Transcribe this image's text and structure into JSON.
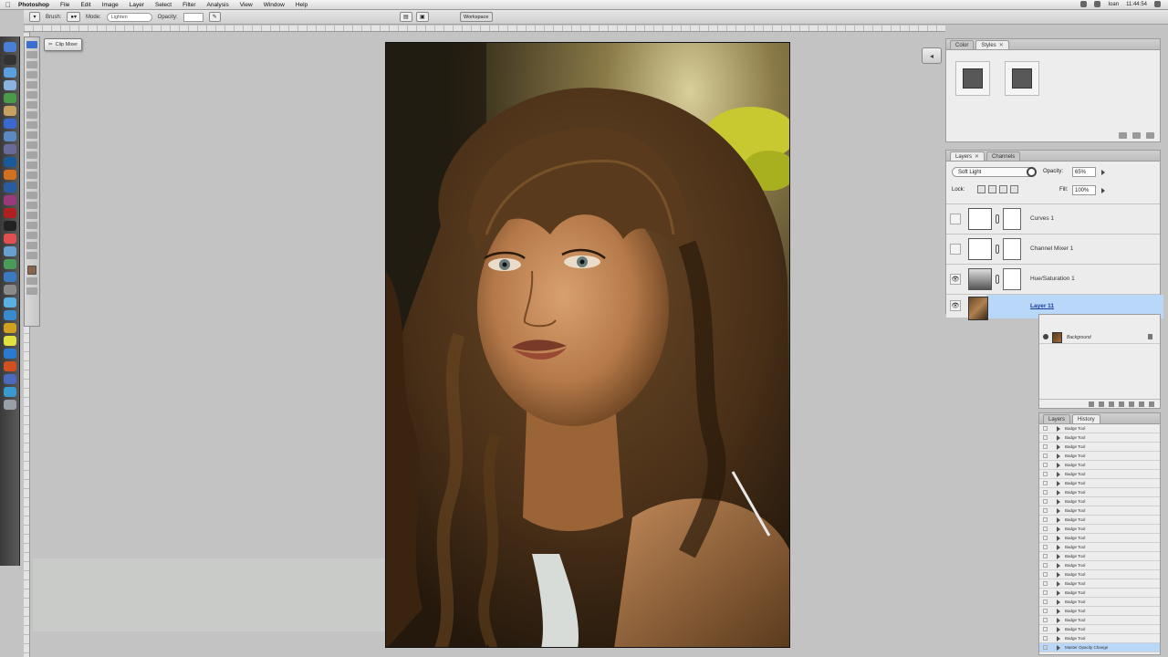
{
  "menubar": {
    "app": "Photoshop",
    "items": [
      "File",
      "Edit",
      "Image",
      "Layer",
      "Select",
      "Filter",
      "Analysis",
      "View",
      "Window",
      "Help"
    ],
    "clock": "11:44:54",
    "user": "Ioan"
  },
  "options": {
    "brush_label": "Brush:",
    "mode_label": "Mode:",
    "mode_value": "Lighten",
    "opacity_label": "Opacity:",
    "workspace": "Workspace"
  },
  "tooltip": {
    "text": "Clip Mixer"
  },
  "styles_panel": {
    "tabs": [
      "Color",
      "Styles"
    ]
  },
  "layers_panel": {
    "tabs": [
      "Layers",
      "Channels"
    ],
    "blend_mode": "Soft Light",
    "opacity_label": "Opacity:",
    "opacity_value": "65%",
    "lock_label": "Lock:",
    "fill_label": "Fill:",
    "fill_value": "100%",
    "layers": [
      {
        "name": "Curves 1",
        "visible": false
      },
      {
        "name": "Channel Mixer 1",
        "visible": false
      },
      {
        "name": "Hue/Saturation 1",
        "visible": true
      },
      {
        "name": "Layer 11",
        "visible": true,
        "selected": true
      }
    ],
    "background_name": "Background"
  },
  "actions_panel": {
    "tabs": [
      "Layers",
      "History"
    ],
    "items": [
      "Badge Tool",
      "Badge Tool",
      "Badge Tool",
      "Badge Tool",
      "Badge Tool",
      "Badge Tool",
      "Badge Tool",
      "Badge Tool",
      "Badge Tool",
      "Badge Tool",
      "Badge Tool",
      "Badge Tool",
      "Badge Tool",
      "Badge Tool",
      "Badge Tool",
      "Badge Tool",
      "Badge Tool",
      "Badge Tool",
      "Badge Tool",
      "Badge Tool",
      "Badge Tool",
      "Badge Tool",
      "Badge Tool",
      "Badge Tool"
    ],
    "last": "Master Opacity Change"
  },
  "colors": {
    "selection": "#b9d7f8",
    "canvas_bg": "#c3c3c3"
  }
}
